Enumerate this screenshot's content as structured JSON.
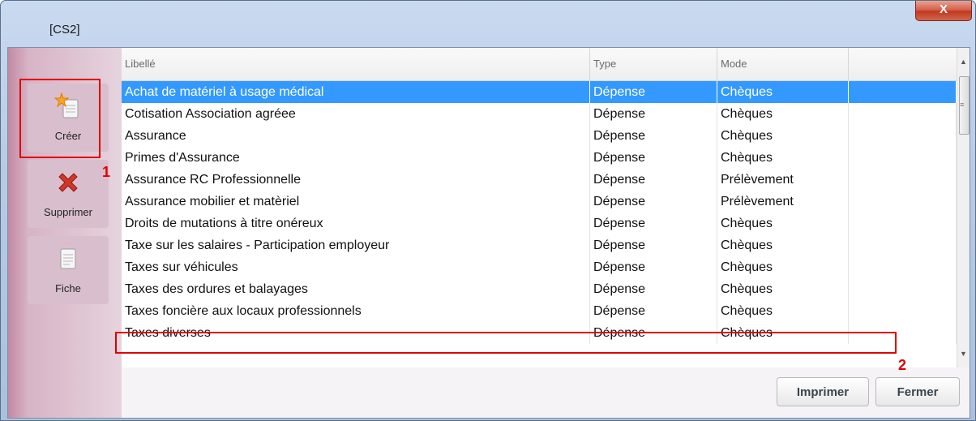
{
  "window": {
    "title": "[CS2]",
    "close_label": "X"
  },
  "sidebar": {
    "items": [
      {
        "label": "Créer",
        "icon": "new-document-icon"
      },
      {
        "label": "Supprimer",
        "icon": "delete-x-icon"
      },
      {
        "label": "Fiche",
        "icon": "document-icon"
      }
    ]
  },
  "table": {
    "columns": [
      "Libellé",
      "Type",
      "Mode"
    ],
    "selected_row": 0,
    "rows": [
      [
        "Achat de matériel à usage médical",
        "Dépense",
        "Chèques"
      ],
      [
        "Cotisation Association agréee",
        "Dépense",
        "Chèques"
      ],
      [
        "Assurance",
        "Dépense",
        "Chèques"
      ],
      [
        "Primes d'Assurance",
        "Dépense",
        "Chèques"
      ],
      [
        "Assurance RC Professionnelle",
        "Dépense",
        "Prélèvement"
      ],
      [
        "Assurance mobilier et matèriel",
        "Dépense",
        "Prélèvement"
      ],
      [
        "Droits de mutations à titre onéreux",
        "Dépense",
        "Chèques"
      ],
      [
        "Taxe sur les salaires - Participation employeur",
        "Dépense",
        "Chèques"
      ],
      [
        "Taxes sur véhicules",
        "Dépense",
        "Chèques"
      ],
      [
        "Taxes des ordures et balayages",
        "Dépense",
        "Chèques"
      ],
      [
        "Taxes foncière aux locaux professionnels",
        "Dépense",
        "Chèques"
      ],
      [
        "Taxes diverses",
        "Dépense",
        "Chèques"
      ]
    ]
  },
  "footer": {
    "print_label": "Imprimer",
    "close_label": "Fermer"
  },
  "annotations": {
    "marker_1": "1",
    "marker_2": "2",
    "highlight_color": "#e00000"
  },
  "colors": {
    "selection": "#3399ff",
    "sidebar": "#d9bfcd"
  }
}
